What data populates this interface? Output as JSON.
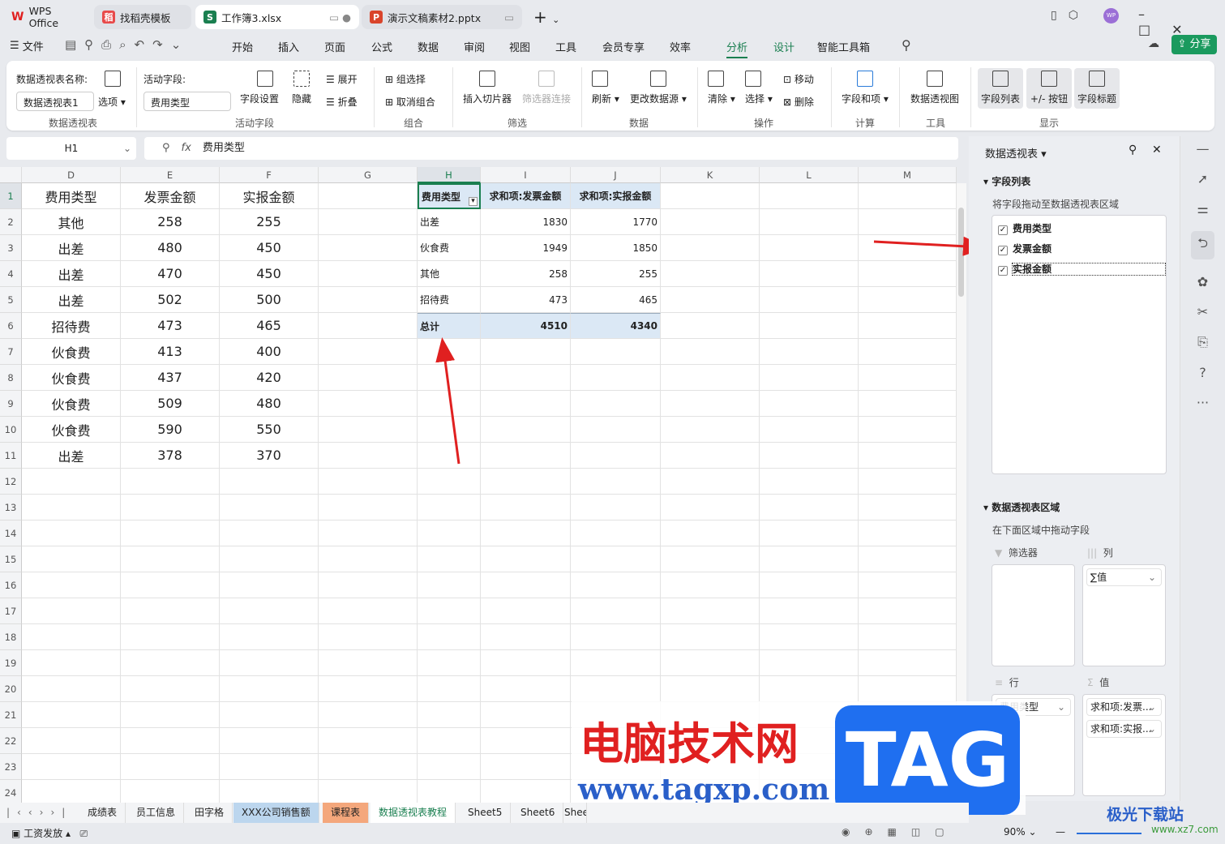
{
  "titlebar": {
    "tabs": [
      {
        "label": "WPS Office",
        "icon": "W"
      },
      {
        "label": "找稻壳模板",
        "icon": "稻"
      },
      {
        "label": "工作簿3.xlsx",
        "icon": "S"
      },
      {
        "label": "演示文稿素材2.pptx",
        "icon": "P"
      }
    ],
    "avatar": "WP"
  },
  "menu": {
    "file": "文件",
    "items": [
      "开始",
      "插入",
      "页面",
      "公式",
      "数据",
      "审阅",
      "视图",
      "工具",
      "会员专享",
      "效率",
      "分析",
      "设计",
      "智能工具箱"
    ],
    "active": "分析",
    "share": "分享"
  },
  "ribbon": {
    "pivot_name_label": "数据透视表名称:",
    "pivot_name_value": "数据透视表1",
    "options": "选项",
    "group1": "数据透视表",
    "active_field_label": "活动字段:",
    "active_field_value": "费用类型",
    "field_settings": "字段设置",
    "hide": "隐藏",
    "expand": "展开",
    "collapse": "折叠",
    "group2": "活动字段",
    "group_select": "组选择",
    "ungroup": "取消组合",
    "group3": "组合",
    "insert_slicer": "插入切片器",
    "filter_conn": "筛选器连接",
    "group4": "筛选",
    "refresh": "刷新",
    "change_source": "更改数据源",
    "group5": "数据",
    "clear": "清除",
    "select": "选择",
    "move": "移动",
    "delete": "删除",
    "group6": "操作",
    "fields_items": "字段和项",
    "group7": "计算",
    "pivot_chart": "数据透视图",
    "group8": "工具",
    "field_list": "字段列表",
    "buttons": "+/- 按钮",
    "field_headers": "字段标题",
    "group9": "显示"
  },
  "formula": {
    "cell_ref": "H1",
    "fx": "fx",
    "value": "费用类型"
  },
  "grid": {
    "columns": [
      "D",
      "E",
      "F",
      "G",
      "H",
      "I",
      "J",
      "K",
      "L",
      "M"
    ],
    "source": [
      [
        "费用类型",
        "发票金额",
        "实报金额"
      ],
      [
        "其他",
        "258",
        "255"
      ],
      [
        "出差",
        "480",
        "450"
      ],
      [
        "出差",
        "470",
        "450"
      ],
      [
        "出差",
        "502",
        "500"
      ],
      [
        "招待费",
        "473",
        "465"
      ],
      [
        "伙食费",
        "413",
        "400"
      ],
      [
        "伙食费",
        "437",
        "420"
      ],
      [
        "伙食费",
        "509",
        "480"
      ],
      [
        "伙食费",
        "590",
        "550"
      ],
      [
        "出差",
        "378",
        "370"
      ]
    ],
    "pivot": [
      [
        "费用类型",
        "求和项:发票金额",
        "求和项:实报金额"
      ],
      [
        "出差",
        "1830",
        "1770"
      ],
      [
        "伙食费",
        "1949",
        "1850"
      ],
      [
        "其他",
        "258",
        "255"
      ],
      [
        "招待费",
        "473",
        "465"
      ],
      [
        "总计",
        "4510",
        "4340"
      ]
    ]
  },
  "panel": {
    "title": "数据透视表",
    "field_list": "字段列表",
    "drag_hint": "将字段拖动至数据透视表区域",
    "fields": [
      {
        "label": "费用类型",
        "checked": true
      },
      {
        "label": "发票金额",
        "checked": true
      },
      {
        "label": "实报金额",
        "checked": true
      }
    ],
    "areas_title": "数据透视表区域",
    "areas_hint": "在下面区域中拖动字段",
    "filter": "筛选器",
    "columns": "列",
    "rows": "行",
    "values": "值",
    "col_items": [
      "∑值"
    ],
    "row_items": [
      "费用类型"
    ],
    "value_items": [
      "求和项:发票...",
      "求和项:实报..."
    ]
  },
  "sheets": {
    "tabs": [
      "成绩表",
      "员工信息",
      "田字格",
      "XXX公司销售额",
      "课程表",
      "数据透视表教程",
      "Sheet5",
      "Sheet6",
      "Shee"
    ],
    "active": "数据透视表教程"
  },
  "status": {
    "left": "工资发放",
    "zoom": "90%"
  },
  "watermark": {
    "text1": "电脑技术网",
    "text2": "www.tagxp.com",
    "tag": "TAG",
    "site": "极光下载站",
    "site_url": "www.xz7.com"
  },
  "colors": {
    "accent": "#1a7f50",
    "arrow": "#e02020"
  }
}
